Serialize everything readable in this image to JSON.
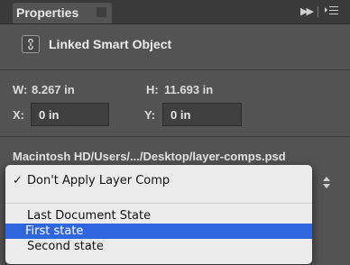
{
  "panel": {
    "tab_title": "Properties",
    "header_label": "Linked Smart Object"
  },
  "dimensions": {
    "w_label": "W:",
    "w_value": "8.267 in",
    "h_label": "H:",
    "h_value": "11.693 in",
    "x_label": "X:",
    "x_value": "0 in",
    "y_label": "Y:",
    "y_value": "0 in"
  },
  "file": {
    "path": "Macintosh HD/Users/.../Desktop/layer-comps.psd"
  },
  "layer_comp_menu": {
    "check_mark": "✓",
    "items": [
      {
        "label": "Don't Apply Layer Comp",
        "checked": true
      },
      {
        "label": "Last Document State"
      },
      {
        "label": "First state",
        "selected": true
      },
      {
        "label": "Second state"
      }
    ]
  },
  "colors": {
    "panel_bg": "#535353",
    "menu_bg": "#ececec",
    "menu_selection": "#2f66e0"
  }
}
